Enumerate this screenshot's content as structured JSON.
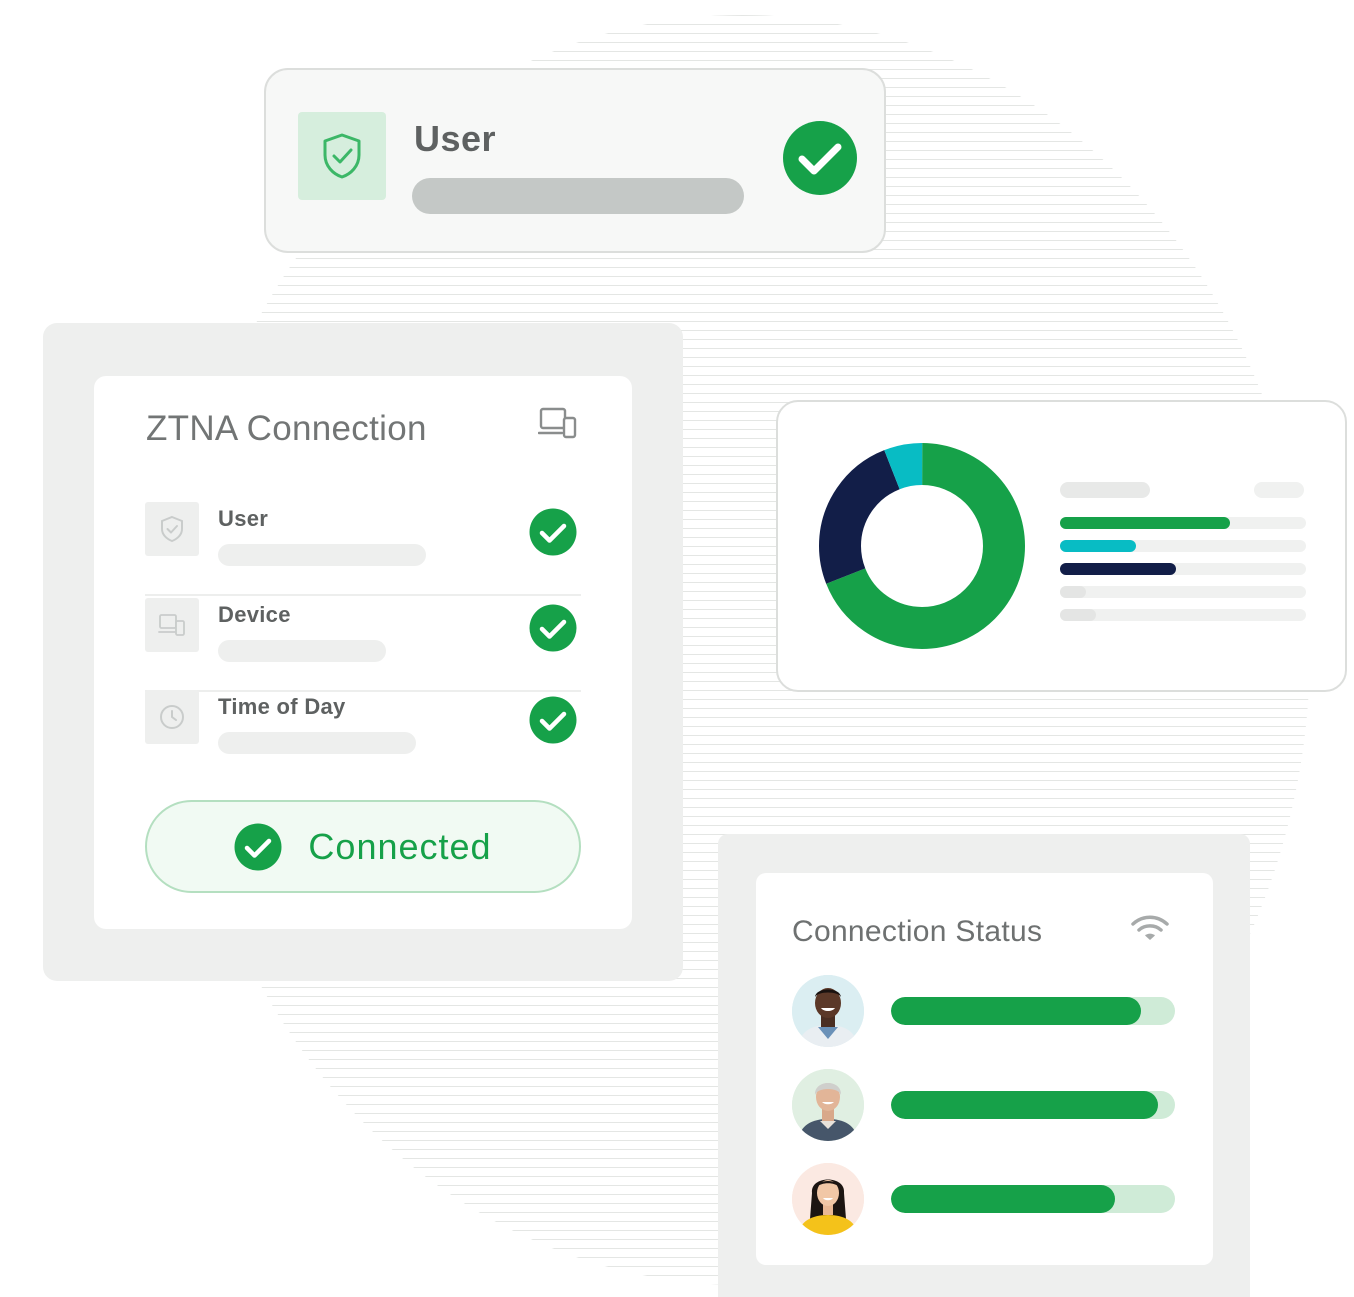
{
  "colors": {
    "accent_green": "#16a149",
    "light_green": "#cfebd7",
    "navy": "#121e48",
    "teal": "#08bcc4",
    "muted_text": "#6e7171"
  },
  "user_card": {
    "title": "User",
    "icon": "shield-check-icon",
    "status_icon": "check-circle-icon"
  },
  "ztna": {
    "title": "ZTNA Connection",
    "header_icon": "devices-icon",
    "checks": [
      {
        "label": "User",
        "icon": "shield-check-icon"
      },
      {
        "label": "Device",
        "icon": "devices-icon"
      },
      {
        "label": "Time of Day",
        "icon": "clock-icon"
      }
    ],
    "button_label": "Connected"
  },
  "chart_data": {
    "type": "pie",
    "values": [
      0.69,
      0.25,
      0.06
    ],
    "colors": [
      "#16a149",
      "#121e48",
      "#08bcc4"
    ],
    "bars": [
      0.69,
      0.31,
      0.47
    ]
  },
  "connection_status": {
    "title": "Connection Status",
    "icon": "wifi-icon",
    "users": [
      {
        "level": 0.88
      },
      {
        "level": 0.94
      },
      {
        "level": 0.79
      }
    ]
  }
}
